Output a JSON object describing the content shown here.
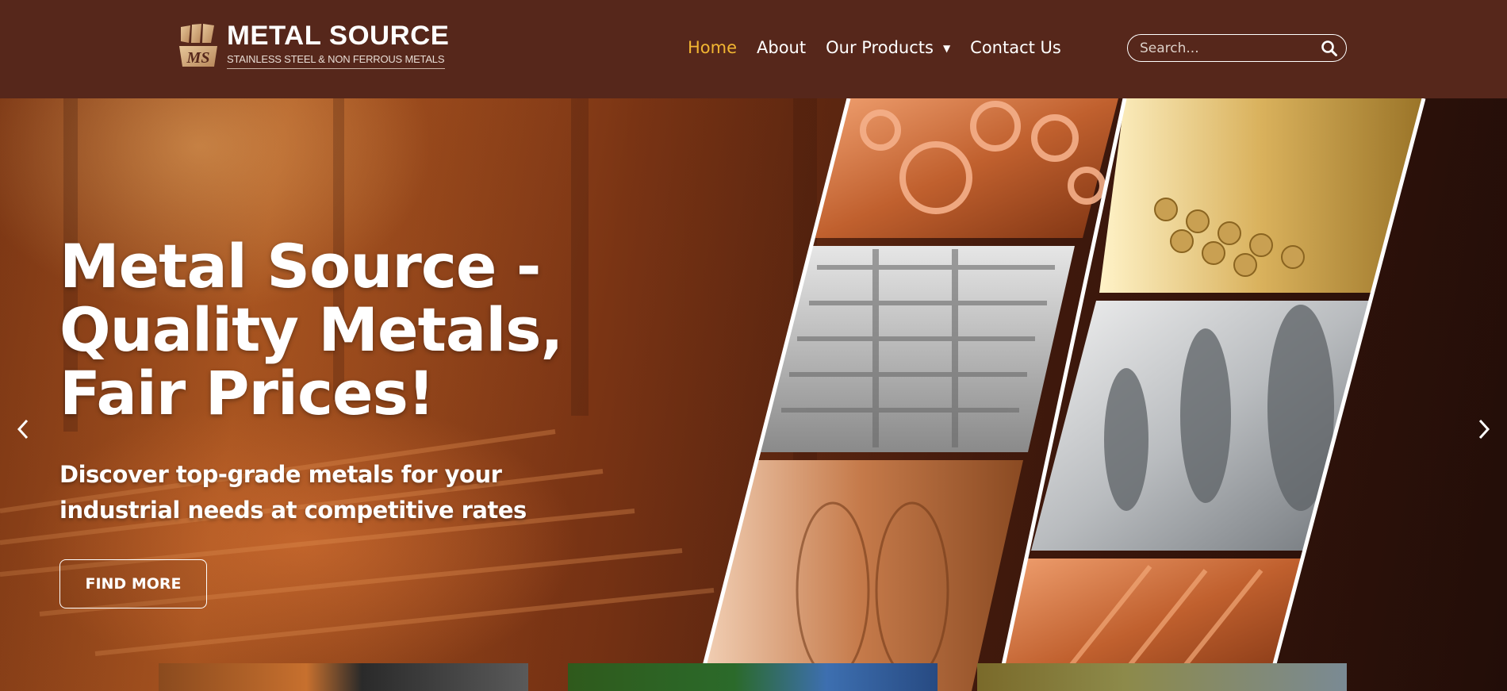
{
  "brand": {
    "name": "METAL SOURCE",
    "tagline": "STAINLESS STEEL & NON FERROUS METALS"
  },
  "nav": {
    "items": [
      {
        "label": "Home",
        "active": true
      },
      {
        "label": "About",
        "active": false
      },
      {
        "label": "Our Products",
        "active": false,
        "dropdown": true
      },
      {
        "label": "Contact Us",
        "active": false
      }
    ]
  },
  "search": {
    "placeholder": "Search..."
  },
  "hero": {
    "title": "Metal Source - Quality Metals, Fair Prices!",
    "subtitle": "Discover top-grade metals for your industrial needs at competitive rates",
    "cta_label": "FIND MORE"
  },
  "colors": {
    "header_bg": "#56271b",
    "nav_active": "#f2b632",
    "text": "#ffffff"
  },
  "icons": {
    "search": "search-icon",
    "prev": "chevron-left-icon",
    "next": "chevron-right-icon",
    "caret": "caret-down-icon"
  }
}
